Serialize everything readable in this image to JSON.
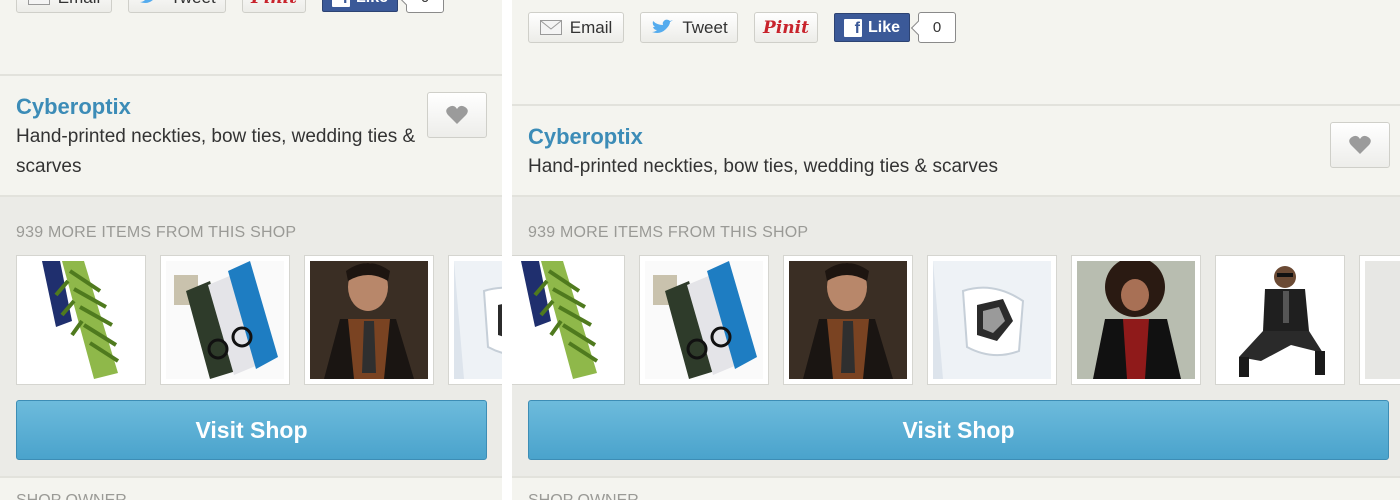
{
  "share": {
    "email_label": "Email",
    "tweet_label": "Tweet",
    "pin_label": "Pinit",
    "like_label": "Like",
    "like_count": "0"
  },
  "shop": {
    "name": "Cyberoptix",
    "description": "Hand-printed neckties, bow ties, wedding ties & scarves"
  },
  "more_items": {
    "label": "939 MORE ITEMS FROM THIS SHOP",
    "thumbnails": [
      "green-fern-tie",
      "tie-trio",
      "man-brown-shirt",
      "white-print-scarf",
      "man-red-shirt",
      "seated-man-tie",
      "partial-item"
    ]
  },
  "visit_shop_label": "Visit Shop",
  "owner_label": "SHOP OWNER",
  "colors": {
    "link": "#3c8cb7",
    "button": "#4aa3cc",
    "facebook": "#3b5998",
    "pinterest": "#c8232c",
    "twitter": "#55acee"
  }
}
